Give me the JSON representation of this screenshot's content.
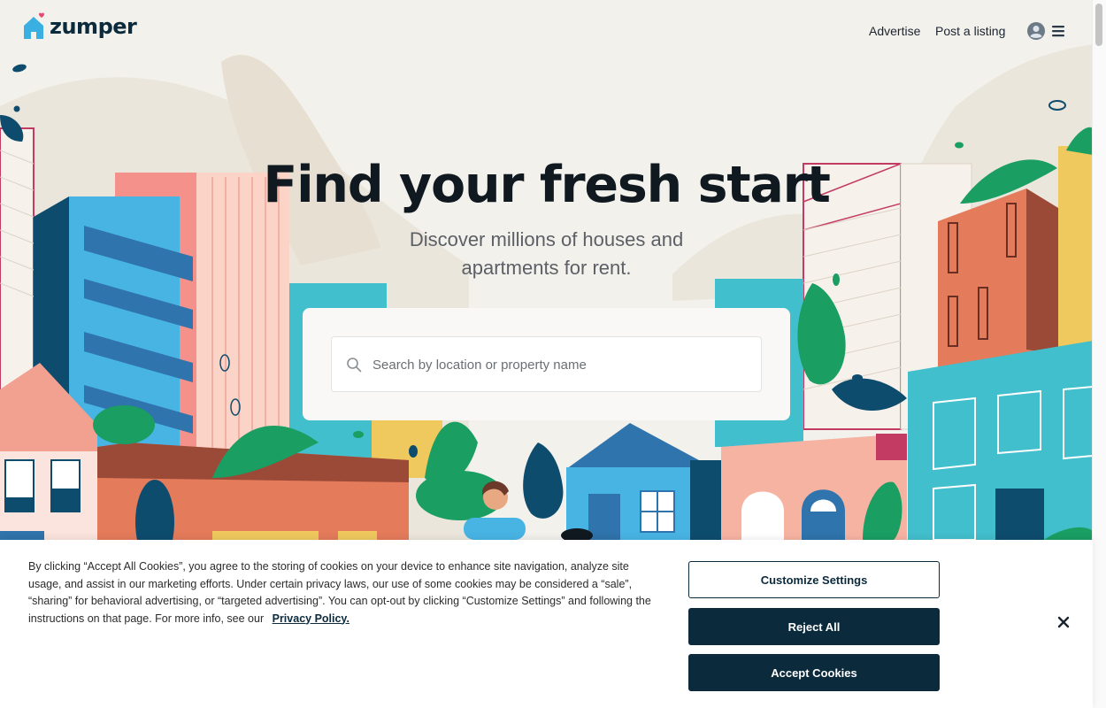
{
  "brand": {
    "name": "zumper",
    "color": "#0b2a3c",
    "accent": "#3ab0e2"
  },
  "nav": {
    "advertise": "Advertise",
    "post_listing": "Post a listing",
    "user_icon": "user-circle-icon",
    "menu_icon": "hamburger-menu-icon"
  },
  "hero": {
    "title": "Find your fresh start",
    "subtitle_line1": "Discover millions of houses and",
    "subtitle_line2": "apartments for rent."
  },
  "search": {
    "placeholder": "Search by location or property name",
    "value": "",
    "icon": "search-icon"
  },
  "cookie_banner": {
    "text": "By clicking “Accept All Cookies”, you agree to the storing of cookies on your device to enhance site navigation, analyze site usage, and assist in our marketing efforts. Under certain privacy laws, our use of some cookies may be considered a “sale”, “sharing” for behavioral advertising, or “targeted advertising”. You can opt-out by clicking “Customize Settings” and following the instructions on that page. For more info, see our",
    "privacy_link": "Privacy Policy.",
    "customize_label": "Customize Settings",
    "reject_label": "Reject All",
    "accept_label": "Accept Cookies",
    "close_icon": "close-icon",
    "button_color": "#0b2a3c"
  }
}
